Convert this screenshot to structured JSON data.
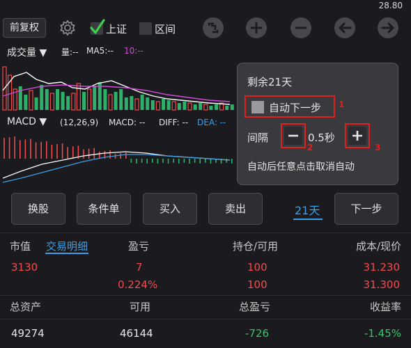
{
  "status": {
    "price": "28.80"
  },
  "toolbar": {
    "fuquan_label": "前复权",
    "checkbox_sz": {
      "label": "上证",
      "checked": true
    },
    "checkbox_range": {
      "label": "区间",
      "checked": false
    },
    "icons": [
      "gear-icon",
      "fit-icon",
      "plus-icon",
      "minus-icon",
      "arrow-left-icon",
      "arrow-right-icon"
    ]
  },
  "chart": {
    "volume_title": "成交量 ▼",
    "volume_qty": "量:--",
    "ma5": "MA5:--",
    "ma10": "10:--",
    "macd_title": "MACD ▼",
    "macd_params": "(12,26,9)",
    "macd_val": "MACD: --",
    "diff_val": "DIFF: --",
    "dea_val": "DEA: --",
    "colors": {
      "up": "#ef4d4d",
      "down": "#2fb06a",
      "ma5": "#ffffff",
      "ma10": "#d24ad8",
      "dea": "#3aa0e8"
    }
  },
  "popup": {
    "remaining": "剩余21天",
    "auto_next_label": "自动下一步",
    "marker_1": "1",
    "interval_label": "间隔",
    "interval_value": "0.5秒",
    "marker_2": "2",
    "marker_3": "3",
    "hint": "自动后任意点击取消自动"
  },
  "actions": {
    "switch_stock": "换股",
    "conditional_order": "条件单",
    "buy": "买入",
    "sell": "卖出",
    "days": "21天",
    "next_step": "下一步"
  },
  "table": {
    "headers1": {
      "market_value": "市值",
      "trade_detail": "交易明细",
      "pnl": "盈亏",
      "position": "持仓/可用",
      "cost_price": "成本/现价"
    },
    "row1": {
      "market_value": "3130",
      "pnl": "7",
      "position": "100",
      "cost": "31.230"
    },
    "row2": {
      "pnl_pct": "0.224%",
      "available": "100",
      "price": "31.300"
    },
    "headers2": {
      "total_assets": "总资产",
      "available": "可用",
      "total_pnl": "总盈亏",
      "return_rate": "收益率"
    },
    "row3": {
      "total_assets": "49274",
      "available": "46144",
      "total_pnl": "-726",
      "return_rate": "-1.45%"
    }
  }
}
